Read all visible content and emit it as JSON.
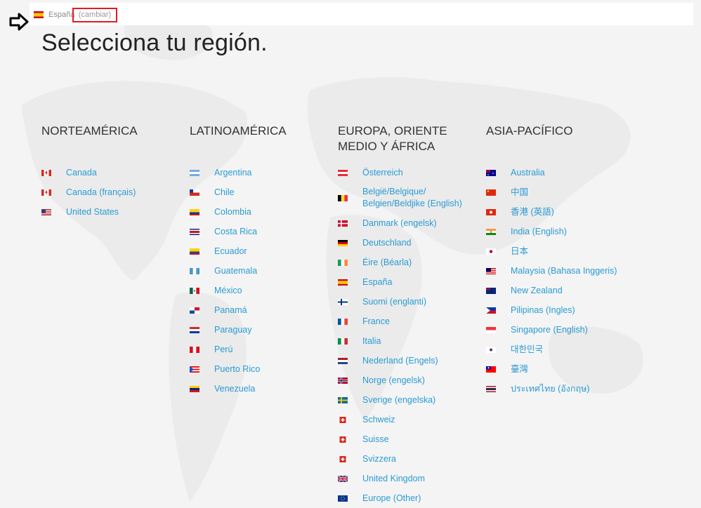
{
  "header": {
    "current_region": "España",
    "change_label": "(cambiar)"
  },
  "page": {
    "title": "Selecciona tu región."
  },
  "regions": [
    {
      "title": "NORTEAMÉRICA",
      "items": [
        {
          "label": "Canada",
          "flag": "ca"
        },
        {
          "label": "Canada (français)",
          "flag": "ca"
        },
        {
          "label": "United States",
          "flag": "us"
        }
      ]
    },
    {
      "title": "LATINOAMÉRICA",
      "items": [
        {
          "label": "Argentina",
          "flag": "ar"
        },
        {
          "label": "Chile",
          "flag": "cl"
        },
        {
          "label": "Colombia",
          "flag": "co"
        },
        {
          "label": "Costa Rica",
          "flag": "cr"
        },
        {
          "label": "Ecuador",
          "flag": "ec"
        },
        {
          "label": "Guatemala",
          "flag": "gt"
        },
        {
          "label": "México",
          "flag": "mx"
        },
        {
          "label": "Panamá",
          "flag": "pa"
        },
        {
          "label": "Paraguay",
          "flag": "py"
        },
        {
          "label": "Perú",
          "flag": "pe"
        },
        {
          "label": "Puerto Rico",
          "flag": "pr"
        },
        {
          "label": "Venezuela",
          "flag": "ve"
        }
      ]
    },
    {
      "title": "EUROPA, ORIENTE MEDIO Y ÁFRICA",
      "items": [
        {
          "label": "Österreich",
          "flag": "at"
        },
        {
          "label": "België/Belgique/ Belgien/Beldjike (English)",
          "flag": "be"
        },
        {
          "label": "Danmark (engelsk)",
          "flag": "dk"
        },
        {
          "label": "Deutschland",
          "flag": "de"
        },
        {
          "label": "Éire (Béarla)",
          "flag": "ie"
        },
        {
          "label": "España",
          "flag": "es"
        },
        {
          "label": "Suomi (englanti)",
          "flag": "fi"
        },
        {
          "label": "France",
          "flag": "fr"
        },
        {
          "label": "Italia",
          "flag": "it"
        },
        {
          "label": "Nederland (Engels)",
          "flag": "nl"
        },
        {
          "label": "Norge (engelsk)",
          "flag": "no"
        },
        {
          "label": "Sverige (engelska)",
          "flag": "se"
        },
        {
          "label": "Schweiz",
          "flag": "ch"
        },
        {
          "label": "Suisse",
          "flag": "ch"
        },
        {
          "label": "Svizzera",
          "flag": "ch"
        },
        {
          "label": "United Kingdom",
          "flag": "gb"
        },
        {
          "label": "Europe (Other)",
          "flag": "eu"
        }
      ]
    },
    {
      "title": "ASIA-PACÍFICO",
      "items": [
        {
          "label": "Australia",
          "flag": "au"
        },
        {
          "label": "中国",
          "flag": "cn"
        },
        {
          "label": "香港 (英語)",
          "flag": "hk"
        },
        {
          "label": "India (English)",
          "flag": "in"
        },
        {
          "label": "日本",
          "flag": "jp"
        },
        {
          "label": "Malaysia (Bahasa Inggeris)",
          "flag": "my"
        },
        {
          "label": "New Zealand",
          "flag": "nz"
        },
        {
          "label": "Pilipinas (Ingles)",
          "flag": "ph"
        },
        {
          "label": "Singapore (English)",
          "flag": "sg"
        },
        {
          "label": "대한민국",
          "flag": "kr"
        },
        {
          "label": "臺灣",
          "flag": "tw"
        },
        {
          "label": "ประเทศไทย (อังกฤษ)",
          "flag": "th"
        }
      ]
    }
  ],
  "colors": {
    "link": "#2a9bd4",
    "highlight": "#e21b23",
    "map": "#e9e9e9",
    "bg": "#f4f4f4"
  }
}
